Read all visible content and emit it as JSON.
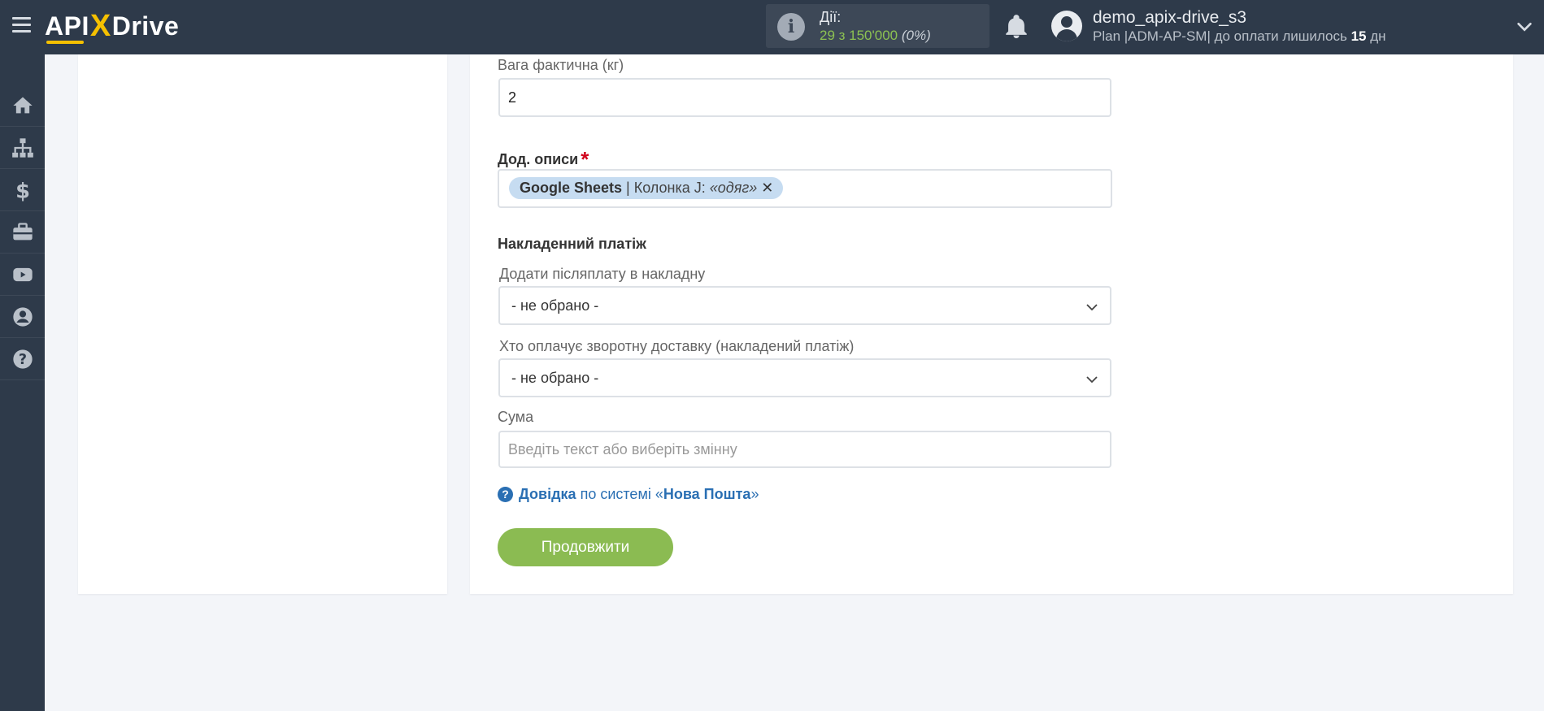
{
  "header": {
    "logo_api": "API",
    "logo_x": "X",
    "logo_drive": "Drive",
    "actions_label": "Дії:",
    "actions_value": "29 з 150'000",
    "actions_percent": "(0%)",
    "user_name": "demo_apix-drive_s3",
    "plan_text": "Plan |ADM-AP-SM| до оплати лишилось",
    "plan_days": "15",
    "plan_days_unit": "дн"
  },
  "sidebar": {
    "items": [
      {
        "icon": "home-icon"
      },
      {
        "icon": "sitemap-icon"
      },
      {
        "icon": "dollar-icon"
      },
      {
        "icon": "briefcase-icon"
      },
      {
        "icon": "youtube-icon"
      },
      {
        "icon": "user-circle-icon"
      },
      {
        "icon": "help-icon"
      }
    ]
  },
  "form": {
    "weight_label": "Вага фактична (кг)",
    "weight_value": "2",
    "desc_label": "Дод. описи",
    "desc_required": "*",
    "desc_tag_source": "Google Sheets",
    "desc_tag_column": "| Колонка J:",
    "desc_tag_value": "«одяг»",
    "desc_tag_remove": "✕",
    "cod_section": "Накладенний платіж",
    "cod_add_label": "Додати післяплату в накладну",
    "cod_add_value": "- не обрано -",
    "cod_payer_label": "Хто оплачує зворотну доставку (накладений платіж)",
    "cod_payer_value": "- не обрано -",
    "sum_label": "Сума",
    "sum_placeholder": "Введіть текст або виберіть змінну"
  },
  "help": {
    "link": "Довідка",
    "middle": "по системі «",
    "system": "Нова Пошта",
    "end": "»"
  },
  "actions": {
    "continue_label": "Продовжити"
  },
  "colors": {
    "topbar": "#2e3a4a",
    "accent_green": "#8bbb52",
    "link_blue": "#2a6fb3",
    "tag_bg": "#c6dcf1"
  }
}
